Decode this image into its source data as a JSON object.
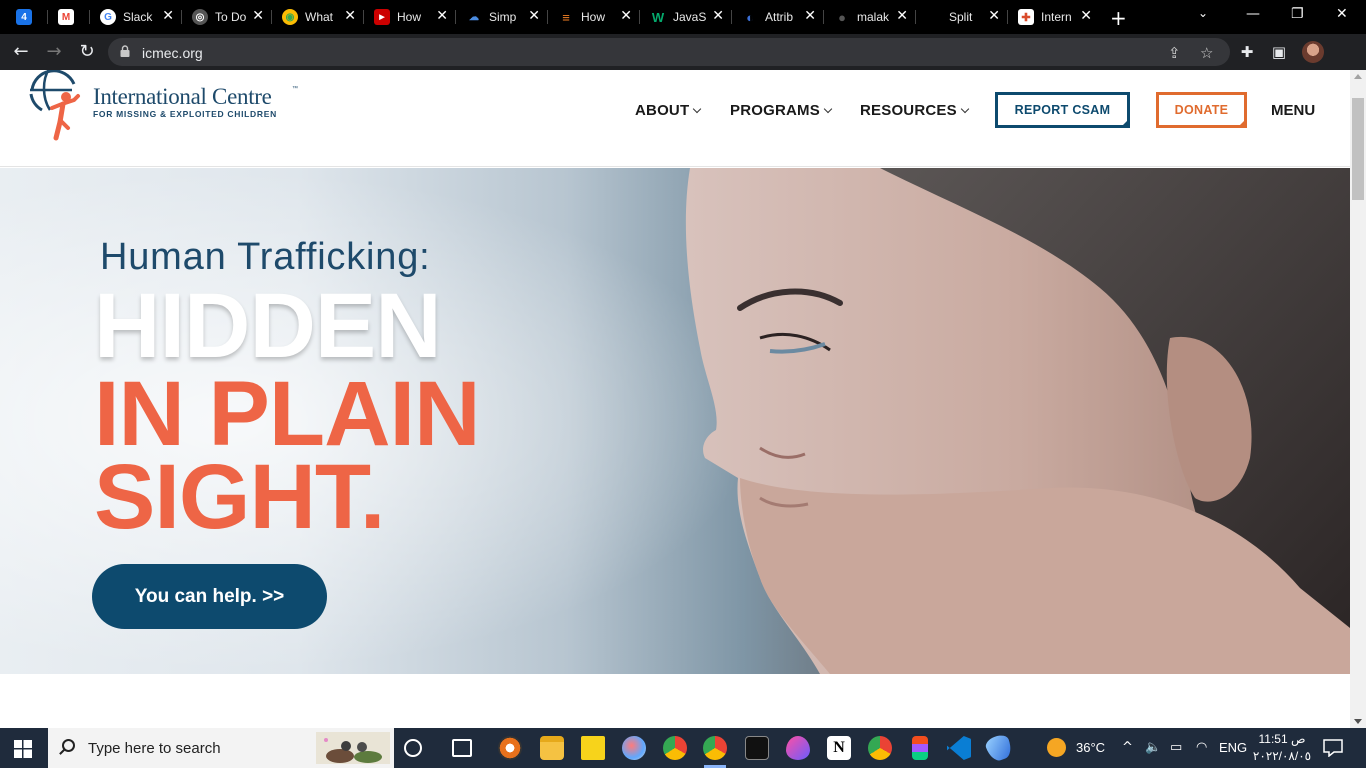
{
  "browser": {
    "tabs": [
      {
        "title": "",
        "favicon": "calendar-icon",
        "color": "#1a73e8",
        "glyph": "4"
      },
      {
        "title": "",
        "favicon": "gmail-icon",
        "color": "#ea4335",
        "glyph": "M"
      },
      {
        "title": "Slack",
        "favicon": "google-icon",
        "color": "#4285f4",
        "glyph": "G"
      },
      {
        "title": "To Do",
        "favicon": "globe-icon",
        "color": "#777777",
        "glyph": "◎"
      },
      {
        "title": "What",
        "favicon": "chrome-icon",
        "color": "#34a853",
        "glyph": "◉"
      },
      {
        "title": "How",
        "favicon": "video-icon",
        "color": "#cc0000",
        "glyph": "▶"
      },
      {
        "title": "Simp",
        "favicon": "cloud-icon",
        "color": "#1565c0",
        "glyph": "☁"
      },
      {
        "title": "How",
        "favicon": "stack-icon",
        "color": "#f48024",
        "glyph": "≡"
      },
      {
        "title": "JavaS",
        "favicon": "w3-icon",
        "color": "#04aa6d",
        "glyph": "W"
      },
      {
        "title": "Attrib",
        "favicon": "wave-icon",
        "color": "#3b6fd6",
        "glyph": "◐"
      },
      {
        "title": "malak",
        "favicon": "github-icon",
        "color": "#333333",
        "glyph": "●"
      },
      {
        "title": "Split",
        "favicon": "none",
        "color": "#000000",
        "glyph": ""
      },
      {
        "title": "Intern",
        "favicon": "icmec-icon",
        "color": "#ffffff",
        "glyph": "✚"
      }
    ],
    "url": "icmec.org"
  },
  "site": {
    "logo_name": "International Centre",
    "logo_tm": "™",
    "logo_sub": "FOR MISSING & EXPLOITED CHILDREN",
    "nav": [
      "ABOUT",
      "PROGRAMS",
      "RESOURCES"
    ],
    "report_label": "REPORT CSAM",
    "donate_label": "DONATE",
    "menu_label": "MENU",
    "accent_navy": "#0d4a6e",
    "accent_orange": "#e06b2e",
    "accent_coral": "#ee6546"
  },
  "hero": {
    "kicker": "Human Trafficking:",
    "line1": "HIDDEN",
    "line2": "IN PLAIN",
    "line3": "SIGHT.",
    "cta": "You can help. >>"
  },
  "taskbar": {
    "search_placeholder": "Type here to search",
    "weather": "36°C",
    "language": "ENG",
    "time": "11:51 ص",
    "date": "٢٠٢٢/٠٨/٠٥"
  }
}
